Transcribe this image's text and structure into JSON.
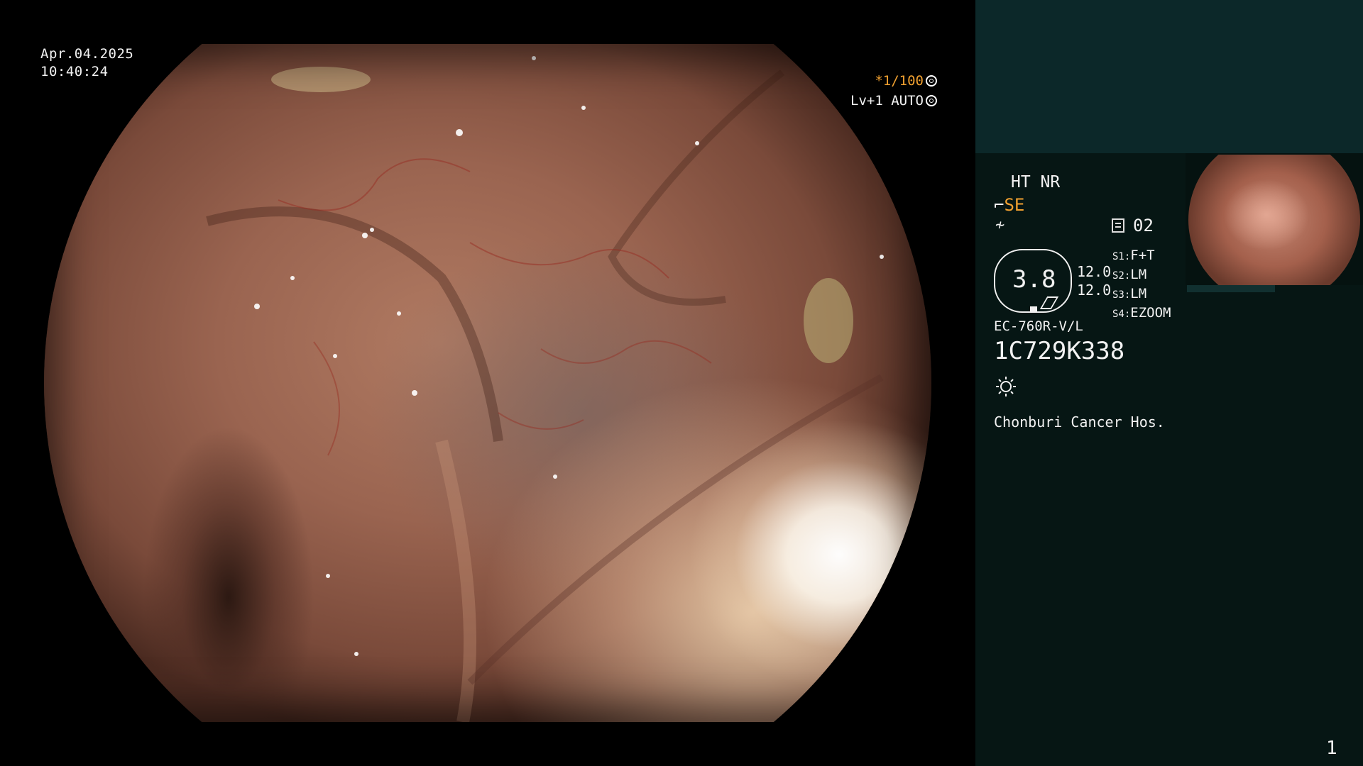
{
  "overlay": {
    "date": "Apr.04.2025",
    "time": "10:40:24",
    "shutter_speed": "*1/100",
    "enhance_level": "Lv+1 AUTO"
  },
  "panel": {
    "ht_nr": "HT NR",
    "se_label": "SE",
    "memory_number": "02",
    "magnification_value": "3.8",
    "side_value_1": "12.0",
    "side_value_2": "12.0",
    "slots": [
      {
        "key": "S1:",
        "value": "F+T"
      },
      {
        "key": "S2:",
        "value": "LM"
      },
      {
        "key": "S3:",
        "value": "LM"
      },
      {
        "key": "S4:",
        "value": "EZOOM"
      }
    ],
    "scope_model": "EC-760R-V/L",
    "serial_number": "1C729K338",
    "hospital": "Chonburi Cancer Hos.",
    "page_number": "1"
  },
  "icons": [
    "shutter-mode-icon",
    "scope-tip-icon",
    "freeze-icon",
    "memory-icon",
    "light-icon"
  ],
  "colors": {
    "accent_orange": "#f0a030",
    "panel_top_bg": "#0c2829",
    "panel_bg": "#061614",
    "text": "#f2f2f2"
  }
}
